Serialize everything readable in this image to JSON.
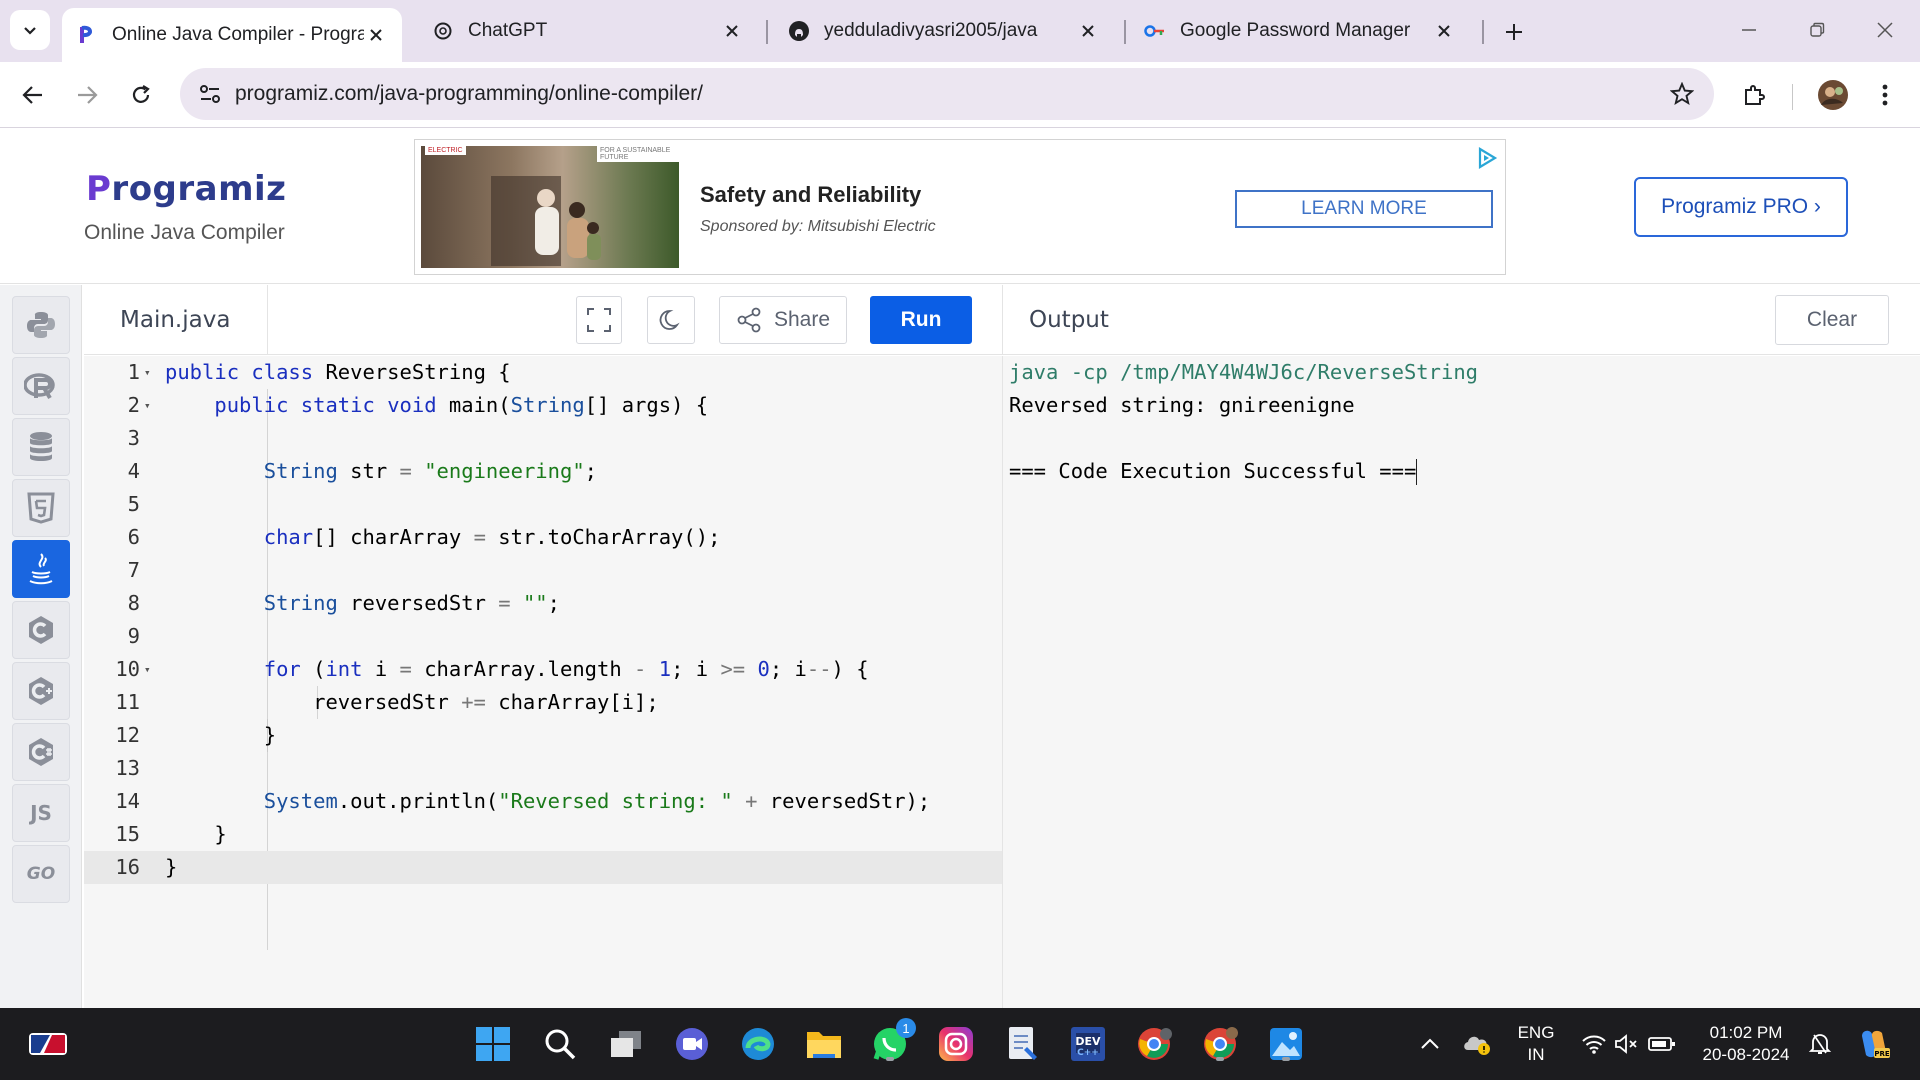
{
  "browser": {
    "tabs": [
      {
        "title": "Online Java Compiler - Program",
        "active": true
      },
      {
        "title": "ChatGPT",
        "active": false
      },
      {
        "title": "yedduladivyasri2005/java",
        "active": false
      },
      {
        "title": "Google Password Manager",
        "active": false
      }
    ],
    "url": "programiz.com/java-programming/online-compiler/"
  },
  "header": {
    "logo": "rogramiz",
    "logo_initial": "P",
    "subtitle": "Online Java Compiler",
    "pro_button": "Programiz PRO ›",
    "ad": {
      "headline": "Safety and Reliability",
      "sponsor": "Sponsored by: Mitsubishi Electric",
      "cta": "LEARN MORE",
      "brand": "ELECTRIC",
      "tagline": "FOR A SUSTAINABLE FUTURE"
    }
  },
  "sidebar": {
    "languages": [
      {
        "name": "python-icon",
        "glyph": ""
      },
      {
        "name": "r-icon",
        "glyph": "R"
      },
      {
        "name": "sql-icon",
        "glyph": ""
      },
      {
        "name": "html-icon",
        "glyph": "5"
      },
      {
        "name": "java-icon",
        "glyph": "",
        "active": true
      },
      {
        "name": "c-icon",
        "glyph": "C"
      },
      {
        "name": "cpp-icon",
        "glyph": "C"
      },
      {
        "name": "csharp-icon",
        "glyph": "C"
      },
      {
        "name": "js-icon",
        "glyph": "JS"
      },
      {
        "name": "go-icon",
        "glyph": "GO"
      }
    ]
  },
  "editor": {
    "filename": "Main.java",
    "share_label": "Share",
    "run_label": "Run",
    "lines": [
      {
        "n": "1",
        "text": "public class ReverseString {",
        "fold": true
      },
      {
        "n": "2",
        "text": "    public static void main(String[] args) {",
        "fold": true
      },
      {
        "n": "3",
        "text": ""
      },
      {
        "n": "4",
        "text": "        String str = \"engineering\";"
      },
      {
        "n": "5",
        "text": ""
      },
      {
        "n": "6",
        "text": "        char[] charArray = str.toCharArray();"
      },
      {
        "n": "7",
        "text": ""
      },
      {
        "n": "8",
        "text": "        String reversedStr = \"\";"
      },
      {
        "n": "9",
        "text": ""
      },
      {
        "n": "10",
        "text": "        for (int i = charArray.length - 1; i >= 0; i--) {",
        "fold": true
      },
      {
        "n": "11",
        "text": "            reversedStr += charArray[i];"
      },
      {
        "n": "12",
        "text": "        }"
      },
      {
        "n": "13",
        "text": ""
      },
      {
        "n": "14",
        "text": "        System.out.println(\"Reversed string: \" + reversedStr);"
      },
      {
        "n": "15",
        "text": "    }"
      },
      {
        "n": "16",
        "text": "}"
      }
    ]
  },
  "output": {
    "title": "Output",
    "clear_label": "Clear",
    "lines": [
      "java -cp /tmp/MAY4W4WJ6c/ReverseString",
      "Reversed string: gnireenigne",
      "",
      "=== Code Execution Successful ==="
    ]
  },
  "taskbar": {
    "lang_top": "ENG",
    "lang_bottom": "IN",
    "time": "01:02 PM",
    "date": "20-08-2024",
    "whatsapp_badge": "1"
  }
}
